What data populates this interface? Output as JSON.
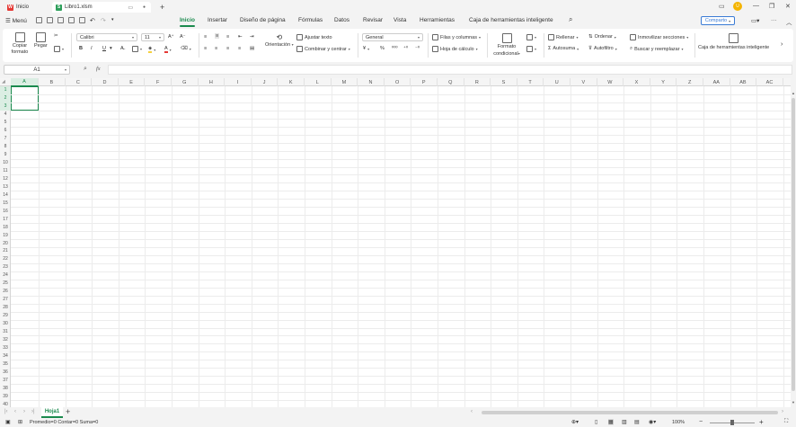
{
  "titlebar": {
    "home_tab": "Inicio",
    "doc_tab": "Libro1.xlsm",
    "avatar_initial": "U"
  },
  "menubar": {
    "menu_label": "Menú",
    "tabs": [
      "Inicio",
      "Insertar",
      "Diseño de página",
      "Fórmulas",
      "Datos",
      "Revisar",
      "Vista",
      "Herramientas",
      "Caja de herramientas inteligente"
    ],
    "share_label": "Comparto"
  },
  "ribbon": {
    "copy_format": "Copiar formato",
    "paste": "Pegar",
    "font_name": "Calibri",
    "font_size": "11",
    "wrap_text": "Ajustar texto",
    "orientation": "Orientación",
    "merge_center": "Combinar y centrar",
    "number_format": "General",
    "rows_columns": "Filas y columnas",
    "worksheet": "Hoja de cálculo",
    "conditional_format": "Formato condicional",
    "fill": "Rellenar",
    "autosum": "Autosuma",
    "sort": "Ordenar",
    "autofilter": "Autofiltro",
    "freeze_panes": "Inmovilizar secciones",
    "find_replace": "Buscar y reemplazar",
    "smart_toolbox": "Caja de herramientas inteligente",
    "bold": "B",
    "italic": "I",
    "underline": "U"
  },
  "formula_bar": {
    "cell_ref": "A1",
    "fx": "fx",
    "value": ""
  },
  "grid": {
    "columns": [
      "A",
      "B",
      "C",
      "D",
      "E",
      "F",
      "G",
      "H",
      "I",
      "J",
      "K",
      "L",
      "M",
      "N",
      "O",
      "P",
      "Q",
      "R",
      "S",
      "T",
      "U",
      "V",
      "W",
      "X",
      "Y",
      "Z",
      "AA",
      "AB",
      "AC"
    ],
    "row_count": 40,
    "selected_column": "A",
    "selected_rows": [
      1,
      2,
      3
    ]
  },
  "sheets": {
    "tabs": [
      "Hoja1"
    ],
    "active": "Hoja1"
  },
  "statusbar": {
    "summary": "Promedio=0  Contar=0  Suma=0",
    "zoom": "100%"
  },
  "colors": {
    "accent": "#1b8a4e",
    "selection_bg": "#dbeee3"
  }
}
